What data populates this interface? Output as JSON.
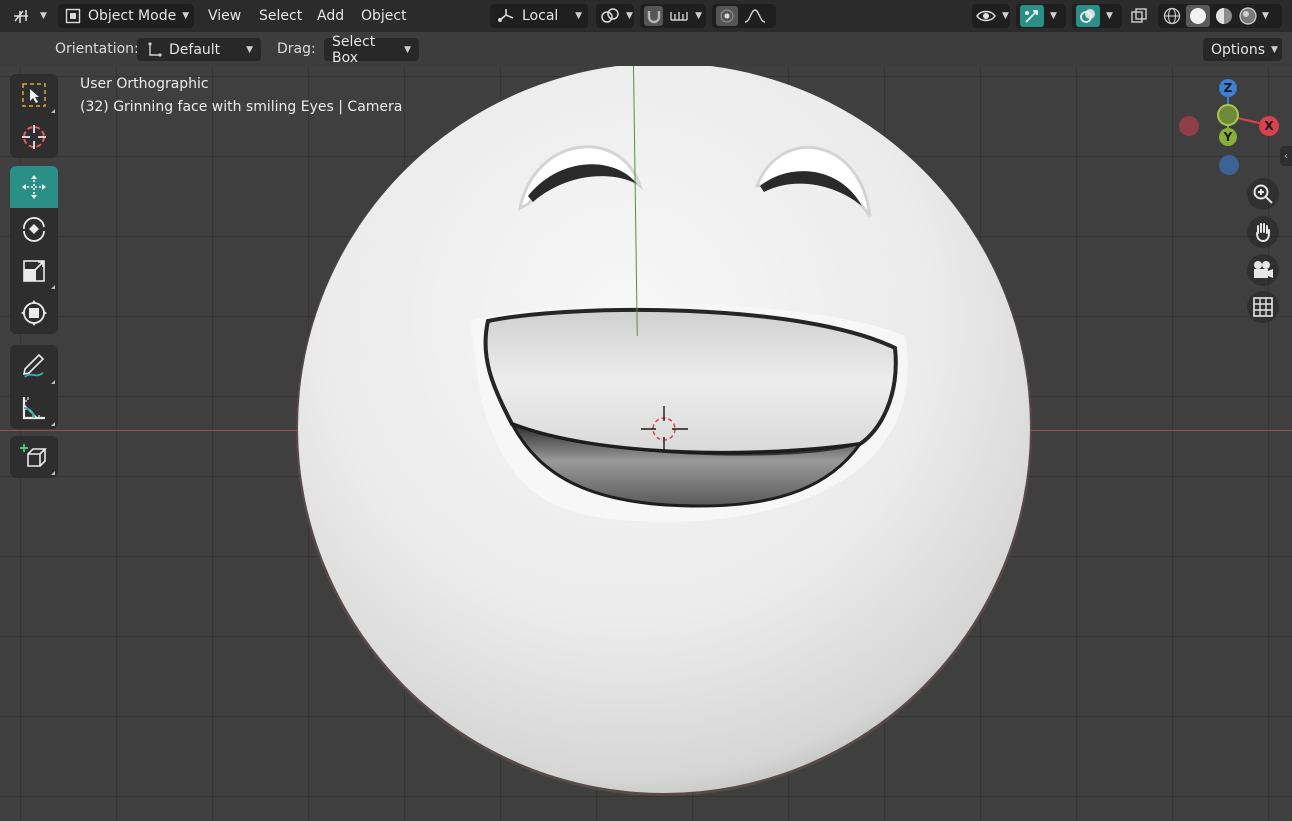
{
  "header": {
    "editor_type_icon": "grid-axes-icon",
    "mode": {
      "icon": "object-mode-icon",
      "label": "Object Mode"
    },
    "menus": [
      "View",
      "Select",
      "Add",
      "Object"
    ],
    "transform_orientation": {
      "icon": "local-orientation-icon",
      "label": "Local"
    },
    "pivot_icon": "pivot-link-icon",
    "snap_icon": "magnet-icon",
    "snap_target_icon": "snap-increment-icon",
    "proportional_icon": "proportional-edit-icon",
    "falloff_icon": "falloff-curve-icon",
    "visibility_icon": "eye-icon",
    "gizmo_icon": "gizmo-icon",
    "overlay_icon": "overlay-icon",
    "xray_icon": "xray-icon",
    "shading_modes": [
      "wireframe-shading-icon",
      "solid-shading-icon",
      "material-shading-icon",
      "rendered-shading-icon"
    ],
    "active_shading": "solid-shading-icon"
  },
  "tool_settings": {
    "orientation_label": "Orientation:",
    "orientation_value": "Default",
    "drag_label": "Drag:",
    "drag_value": "Select Box",
    "options_label": "Options"
  },
  "viewport": {
    "view_name": "User Orthographic",
    "object_info": "(32) Grinning face with smiling Eyes | Camera",
    "gizmo_axes": {
      "z": "Z",
      "y": "Y",
      "x": "X"
    },
    "colors": {
      "x_axis": "#d9414f",
      "y_axis": "#89b034",
      "z_axis": "#3f7fd1",
      "accent": "#2a8f86"
    }
  },
  "tools": [
    "select-box-icon",
    "cursor-icon",
    "move-icon",
    "rotate-icon",
    "scale-icon",
    "transform-icon",
    "annotate-icon",
    "measure-icon",
    "add-cube-icon"
  ],
  "navigation": [
    "zoom-icon",
    "pan-hand-icon",
    "camera-icon",
    "grid-view-icon"
  ]
}
